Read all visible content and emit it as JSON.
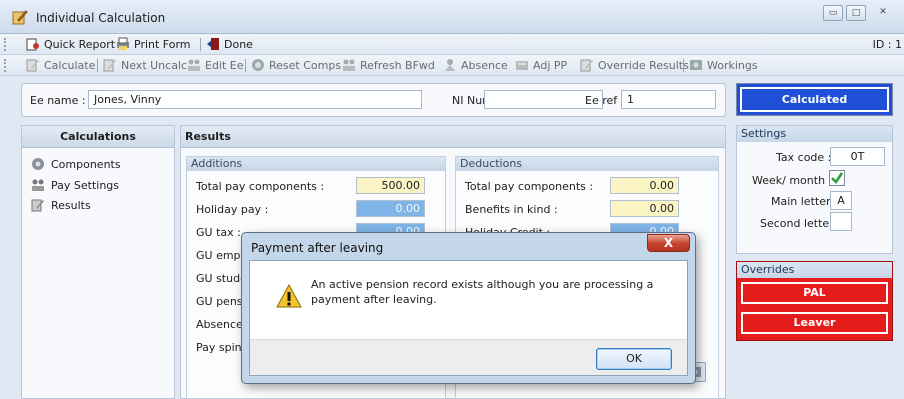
{
  "window": {
    "title": "Individual Calculation",
    "icon": "pencil-calc-icon",
    "controls": {
      "minimize": "▭",
      "maximize": "□",
      "close": "✕"
    }
  },
  "toolbar1": {
    "quick_report": "Quick Report",
    "print_form": "Print Form",
    "done": "Done",
    "id_label": "ID : 1"
  },
  "toolbar2": {
    "calculate": "Calculate",
    "next_uncalc": "Next Uncalc",
    "edit_ee": "Edit Ee",
    "reset_comps": "Reset Comps",
    "refresh_bfwd": "Refresh BFwd",
    "absence": "Absence",
    "adj_pp": "Adj PP",
    "override_results": "Override Results",
    "workings": "Workings"
  },
  "employee": {
    "name_label": "Ee name :",
    "name_value": "Jones, Vinny",
    "ni_label": "NI Number :",
    "ni_value": "",
    "ref_label": "Ee ref :",
    "ref_value": "1"
  },
  "status_button": "Calculated",
  "calculations": {
    "heading": "Calculations",
    "items": [
      {
        "label": "Components",
        "icon": "components-icon"
      },
      {
        "label": "Pay Settings",
        "icon": "pay-settings-icon"
      },
      {
        "label": "Results",
        "icon": "results-icon"
      }
    ]
  },
  "results": {
    "heading": "Results",
    "additions": {
      "heading": "Additions",
      "rows": [
        {
          "label": "Total pay components :",
          "value": "500.00"
        },
        {
          "label": "Holiday pay :",
          "value": "0.00"
        },
        {
          "label": "GU tax :",
          "value": "0.00"
        },
        {
          "label": "GU employ",
          "value": ""
        },
        {
          "label": "GU studen",
          "value": ""
        },
        {
          "label": "GU pensio",
          "value": ""
        },
        {
          "label": "Absence p",
          "value": ""
        },
        {
          "label": "Pay spines",
          "value": ""
        }
      ]
    },
    "deductions": {
      "heading": "Deductions",
      "rows": [
        {
          "label": "Total pay components :",
          "value": "0.00"
        },
        {
          "label": "Benefits in kind :",
          "value": "0.00"
        },
        {
          "label": "Holiday Credit :",
          "value": "0.00"
        }
      ]
    }
  },
  "settings": {
    "heading": "Settings",
    "tax_code_label": "Tax code :",
    "tax_code_value": "0T",
    "week_month_label": "Week/ month 1 :",
    "week_month_checked": true,
    "main_letter_label": "Main letter :",
    "main_letter_value": "A",
    "second_letter_label": "Second letter :",
    "second_letter_value": ""
  },
  "overrides": {
    "heading": "Overrides",
    "pal": "PAL",
    "leaver": "Leaver"
  },
  "dialog": {
    "title": "Payment after leaving",
    "message": "An active pension record exists although you are processing a payment after leaving.",
    "ok": "OK",
    "close": "X",
    "icon": "warning-icon"
  },
  "colors": {
    "status_blue": "#1f4fd6",
    "override_red": "#e51c1c",
    "field_yellow": "#fbf5c6",
    "field_blue": "#7fb4e6"
  }
}
